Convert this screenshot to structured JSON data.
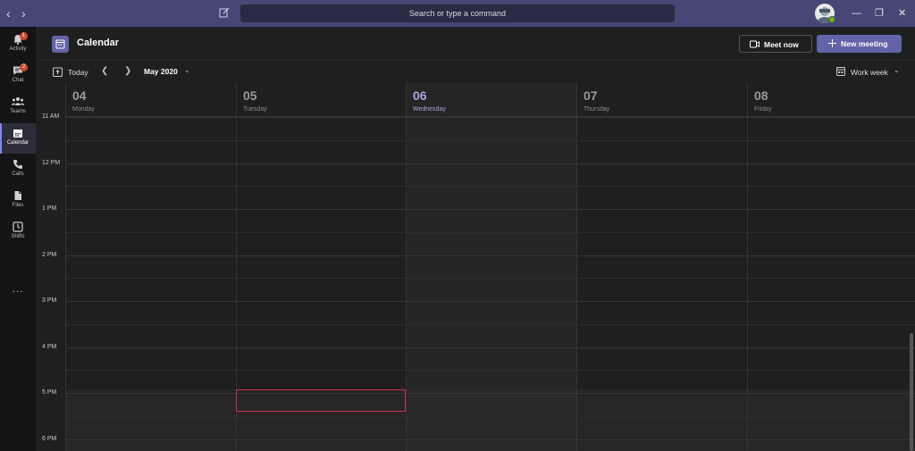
{
  "titlebar": {
    "back_icon": "chevron-left-icon",
    "forward_icon": "chevron-right-icon",
    "search_placeholder": "Search or type a command",
    "window_controls": [
      "minimize",
      "maximize",
      "close"
    ]
  },
  "rail": {
    "items": [
      {
        "label": "Activity",
        "icon": "bell-icon",
        "badge": "1"
      },
      {
        "label": "Chat",
        "icon": "chat-icon",
        "badge": "2"
      },
      {
        "label": "Teams",
        "icon": "teams-icon",
        "badge": ""
      },
      {
        "label": "Calendar",
        "icon": "calendar-icon",
        "badge": "",
        "active": true
      },
      {
        "label": "Calls",
        "icon": "phone-icon",
        "badge": ""
      },
      {
        "label": "Files",
        "icon": "file-icon",
        "badge": ""
      },
      {
        "label": "Shifts",
        "icon": "clock-icon",
        "badge": ""
      }
    ],
    "more": "..."
  },
  "header": {
    "title": "Calendar",
    "meet_now": "Meet now",
    "new_meeting": "New meeting"
  },
  "toolbar": {
    "today": "Today",
    "month": "May 2020",
    "view": "Work week"
  },
  "days": [
    {
      "num": "04",
      "name": "Monday",
      "today": false
    },
    {
      "num": "05",
      "name": "Tuesday",
      "today": false
    },
    {
      "num": "06",
      "name": "Wednesday",
      "today": true
    },
    {
      "num": "07",
      "name": "Thursday",
      "today": false
    },
    {
      "num": "08",
      "name": "Friday",
      "today": false
    }
  ],
  "times": [
    "11 AM",
    "12 PM",
    "1 PM",
    "2 PM",
    "3 PM",
    "4 PM",
    "5 PM",
    "6 PM"
  ],
  "colors": {
    "accent": "#6264a7",
    "titlebar": "#464775",
    "selection": "#c4314b",
    "badge": "#cc4a31",
    "presence": "#6bb700"
  }
}
